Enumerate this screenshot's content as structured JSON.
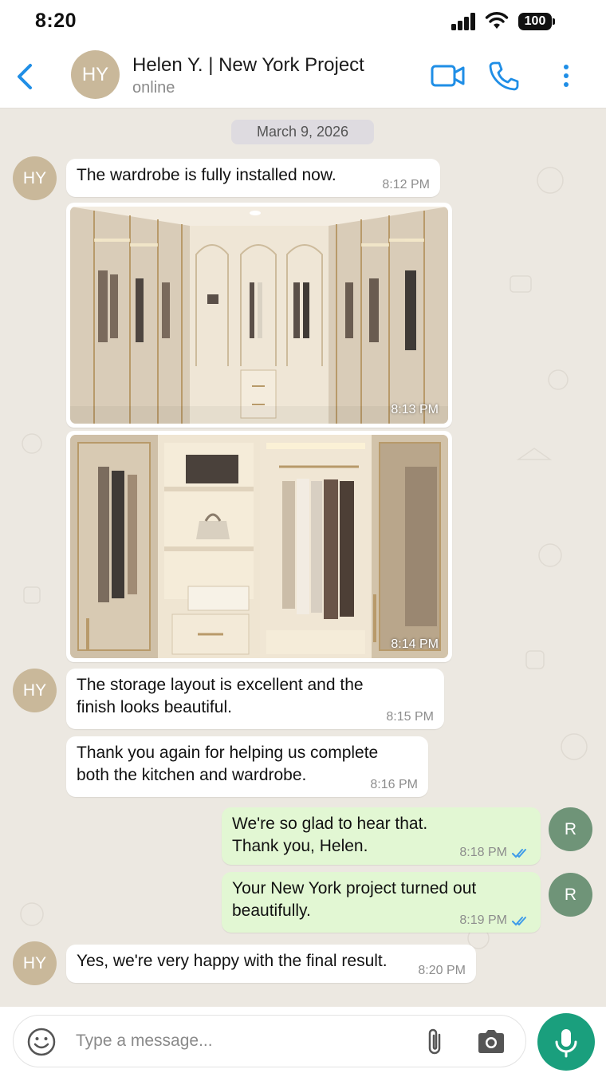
{
  "status_bar": {
    "time": "8:20",
    "battery": "100"
  },
  "header": {
    "avatar_initials": "HY",
    "contact_name": "Helen Y. | New York Project",
    "status": "online"
  },
  "chat": {
    "date": "March 9, 2026",
    "messages": [
      {
        "text": "The wardrobe is fully installed now.",
        "time": "8:12 PM",
        "avatar": "HY"
      },
      {
        "photo_time": "8:13 PM"
      },
      {
        "photo_time": "8:14 PM"
      },
      {
        "text_line1": "The storage layout is excellent and the",
        "text_line2": "finish looks beautiful.",
        "time": "8:15 PM",
        "avatar": "HY"
      },
      {
        "text_line1": "Thank you again for helping us complete",
        "text_line2": "both the kitchen and wardrobe.",
        "time": "8:16 PM"
      },
      {
        "text_line1": "We're so glad to hear that.",
        "text_line2": "Thank you, Helen.",
        "time": "8:18 PM",
        "avatar": "R"
      },
      {
        "text_line1": "Your New York project turned out",
        "text_line2": "beautifully.",
        "time": "8:19 PM",
        "avatar": "R"
      },
      {
        "text": "Yes, we're very happy with the final result.",
        "time": "8:20 PM",
        "avatar": "HY"
      }
    ]
  },
  "composer": {
    "placeholder": "Type a message..."
  },
  "colors": {
    "accent_blue": "#1f8ee6",
    "mic_green": "#1a9f7d",
    "outgoing_bubble": "#e2f7d3",
    "tick_blue": "#3d9be9"
  }
}
